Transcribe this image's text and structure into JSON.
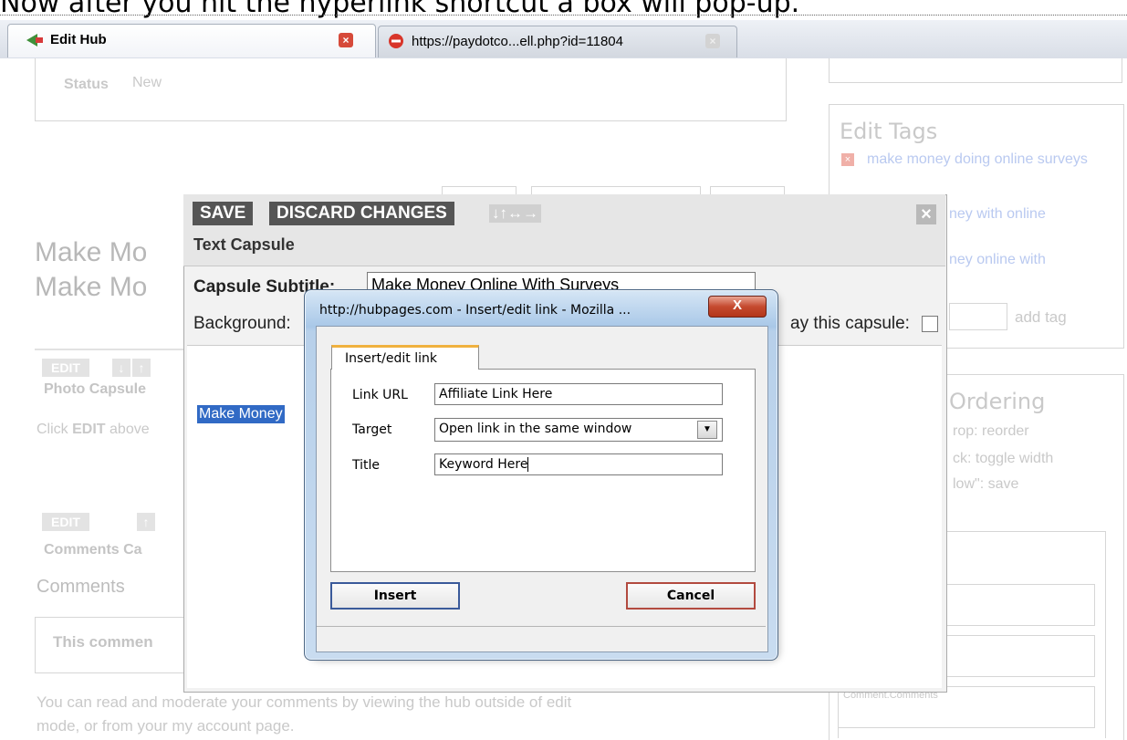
{
  "caption": "Now after you hit the hyperlink shortcut a box will pop-up.",
  "browser": {
    "tab1_title": "Edit Hub",
    "tab2_title": "https://paydotco...ell.php?id=11804"
  },
  "page": {
    "status_label": "Status",
    "status_value": "New",
    "edit_tags_heading": "Edit Tags",
    "tag1": "make money doing online surveys",
    "tag2_fragment": "ney with online",
    "tag3_fragment": "ney online with",
    "add_tag": "add tag",
    "hub_title_1": "Make Mo",
    "hub_title_2": "Make Mo",
    "edit_label": "EDIT",
    "photo_capsule": "Photo Capsule",
    "click_edit_prefix": "Click",
    "click_edit_bold": "EDIT",
    "click_edit_suffix": "above",
    "comments_capsule": "Comments Ca",
    "comments_heading": "Comments",
    "this_comment": "This commen",
    "moderate_text_1": "You can read and moderate your comments by viewing the hub outside of edit",
    "moderate_text_2": "mode, or from your my account page.",
    "ordering_heading": "Ordering",
    "ordering_line1": "rop: reorder",
    "ordering_line2": "ck: toggle width",
    "ordering_line3": "low\": save",
    "comment_placeholder": "Comment.Comments"
  },
  "capsule": {
    "save": "SAVE",
    "discard": "DISCARD CHANGES",
    "close": "×",
    "type": "Text Capsule",
    "subtitle_label": "Capsule Subtitle:",
    "subtitle_value": "Make Money Online With Surveys",
    "background_label": "Background:",
    "display_label": "ay this capsule:",
    "selected_text": "Make Money"
  },
  "dialog": {
    "title": "http://hubpages.com - Insert/edit link - Mozilla ...",
    "close": "X",
    "tab": "Insert/edit link",
    "link_url_label": "Link URL",
    "link_url_value": "Affiliate Link Here",
    "target_label": "Target",
    "target_value": "Open link in the same window",
    "title_label": "Title",
    "title_value": "Keyword Here",
    "insert": "Insert",
    "cancel": "Cancel"
  },
  "colors": {
    "accent_tab": "#f0b13f",
    "dialog_frame": "#b7d0ea",
    "close_red": "#c54a2f",
    "selection_blue": "#316ac5",
    "capsule_dark": "#555555"
  }
}
